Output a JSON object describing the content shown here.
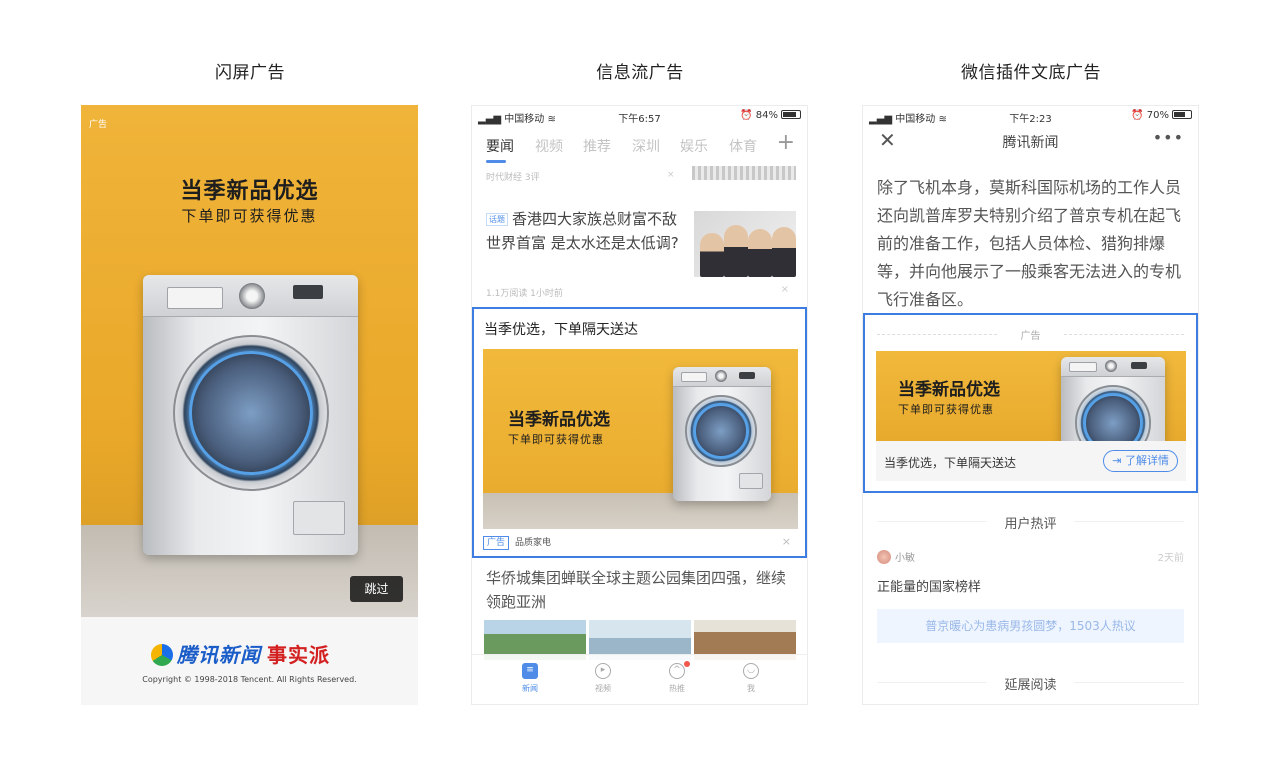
{
  "headings": {
    "splash": "闪屏广告",
    "feed": "信息流广告",
    "article": "微信插件文底广告"
  },
  "splash": {
    "ad_tag": "广告",
    "headline": "当季新品优选",
    "subline": "下单即可获得优惠",
    "skip_label": "跳过",
    "logo_text": "腾讯新闻",
    "logo_slogan": "事实派",
    "copyright": "Copyright © 1998-2018 Tencent. All Rights Reserved."
  },
  "feed": {
    "status": {
      "carrier": "中国移动",
      "time": "下午6:57",
      "battery": "84%",
      "battery_level": 0.84
    },
    "tabs": [
      "要闻",
      "视频",
      "推荐",
      "深圳",
      "娱乐",
      "体育"
    ],
    "active_tab": "要闻",
    "plus_label": "+",
    "prev_meta": "时代财经  3评",
    "story": {
      "tag": "话题",
      "title": "香港四大家族总财富不敌世界首富 是太水还是太低调?",
      "meta": "1.1万阅读  1小时前"
    },
    "ad": {
      "title": "当季优选，下单隔天送达",
      "headline": "当季新品优选",
      "subline": "下单即可获得优惠",
      "tag": "广告",
      "advertiser": "品质家电"
    },
    "story2": {
      "title": "华侨城集团蝉联全球主题公园集团四强，继续领跑亚洲"
    },
    "nav": [
      "新闻",
      "视频",
      "热推",
      "我"
    ],
    "close_symbol": "×"
  },
  "article": {
    "status": {
      "carrier": "中国移动",
      "time": "下午2:23",
      "battery": "70%",
      "battery_level": 0.7
    },
    "title": "腾讯新闻",
    "close_symbol": "✕",
    "more_symbol": "•••",
    "body": "除了飞机本身，莫斯科国际机场的工作人员还向凯普库罗夫特别介绍了普京专机在起飞前的准备工作，包括人员体检、猎狗排爆等，并向他展示了一般乘客无法进入的专机飞行准备区。",
    "ad": {
      "label": "广告",
      "headline": "当季新品优选",
      "subline": "下单即可获得优惠",
      "caption": "当季优选，下单隔天送达",
      "button": "了解详情"
    },
    "comments_heading": "用户热评",
    "comment": {
      "user": "小敏",
      "time": "2天前",
      "text": "正能量的国家榜样"
    },
    "hot_text": "普京暖心为患病男孩圆梦，1503人热议",
    "extended_heading": "延展阅读"
  },
  "colors": {
    "accent": "#3d7ce0",
    "ad_yellow": "#f0b43a",
    "logo_blue": "#1a5cc8",
    "logo_red": "#d32020"
  }
}
